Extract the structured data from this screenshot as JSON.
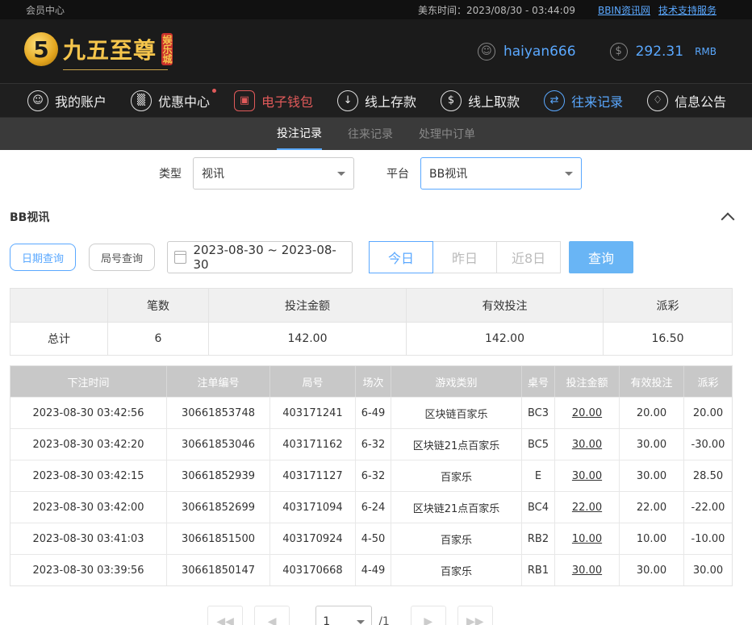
{
  "topbar": {
    "member_center": "会员中心",
    "time_label": "美东时间：2023/08/30 - 03:44:09",
    "link_news": "BBIN资讯网",
    "link_support": "技术支持服务"
  },
  "header": {
    "logo_text": "九五至尊",
    "logo_sub": "娱乐城",
    "logo_icon": "5-coin-icon",
    "username": "haiyan666",
    "balance": "292.31",
    "currency": "RMB"
  },
  "mainnav": {
    "items": [
      {
        "label": "我的账户",
        "icon": "user-icon"
      },
      {
        "label": "优惠中心",
        "icon": "gift-icon"
      },
      {
        "label": "电子钱包",
        "icon": "wallet-icon"
      },
      {
        "label": "线上存款",
        "icon": "deposit-icon"
      },
      {
        "label": "线上取款",
        "icon": "withdraw-icon"
      },
      {
        "label": "往来记录",
        "icon": "records-icon"
      },
      {
        "label": "信息公告",
        "icon": "bell-icon"
      }
    ]
  },
  "subnav": {
    "tabs": [
      "投注记录",
      "往来记录",
      "处理中订单"
    ]
  },
  "filters": {
    "type_label": "类型",
    "type_value": "视讯",
    "platform_label": "平台",
    "platform_value": "BB视讯"
  },
  "section": {
    "title": "BB视讯"
  },
  "query": {
    "date_query": "日期查询",
    "round_query": "局号查询",
    "date_range": "2023-08-30 ~ 2023-08-30",
    "today": "今日",
    "yesterday": "昨日",
    "last8": "近8日",
    "search": "查询"
  },
  "summary": {
    "headers": [
      "",
      "笔数",
      "投注金额",
      "有效投注",
      "派彩"
    ],
    "row": [
      "总计",
      "6",
      "142.00",
      "142.00",
      "16.50"
    ]
  },
  "detail": {
    "headers": [
      "下注时间",
      "注单编号",
      "局号",
      "场次",
      "游戏类别",
      "桌号",
      "投注金额",
      "有效投注",
      "派彩"
    ],
    "rows": [
      [
        "2023-08-30 03:42:56",
        "30661853748",
        "403171241",
        "6-49",
        "区块链百家乐",
        "BC3",
        "20.00",
        "20.00",
        "20.00"
      ],
      [
        "2023-08-30 03:42:20",
        "30661853046",
        "403171162",
        "6-32",
        "区块链21点百家乐",
        "BC5",
        "30.00",
        "30.00",
        "-30.00"
      ],
      [
        "2023-08-30 03:42:15",
        "30661852939",
        "403171127",
        "6-32",
        "百家乐",
        "E",
        "30.00",
        "30.00",
        "28.50"
      ],
      [
        "2023-08-30 03:42:00",
        "30661852699",
        "403171094",
        "6-24",
        "区块链21点百家乐",
        "BC4",
        "22.00",
        "22.00",
        "-22.00"
      ],
      [
        "2023-08-30 03:41:03",
        "30661851500",
        "403170924",
        "4-50",
        "百家乐",
        "RB2",
        "10.00",
        "10.00",
        "-10.00"
      ],
      [
        "2023-08-30 03:39:56",
        "30661850147",
        "403170668",
        "4-49",
        "百家乐",
        "RB1",
        "30.00",
        "30.00",
        "30.00"
      ]
    ]
  },
  "pager": {
    "page": "1",
    "total": "/1"
  }
}
